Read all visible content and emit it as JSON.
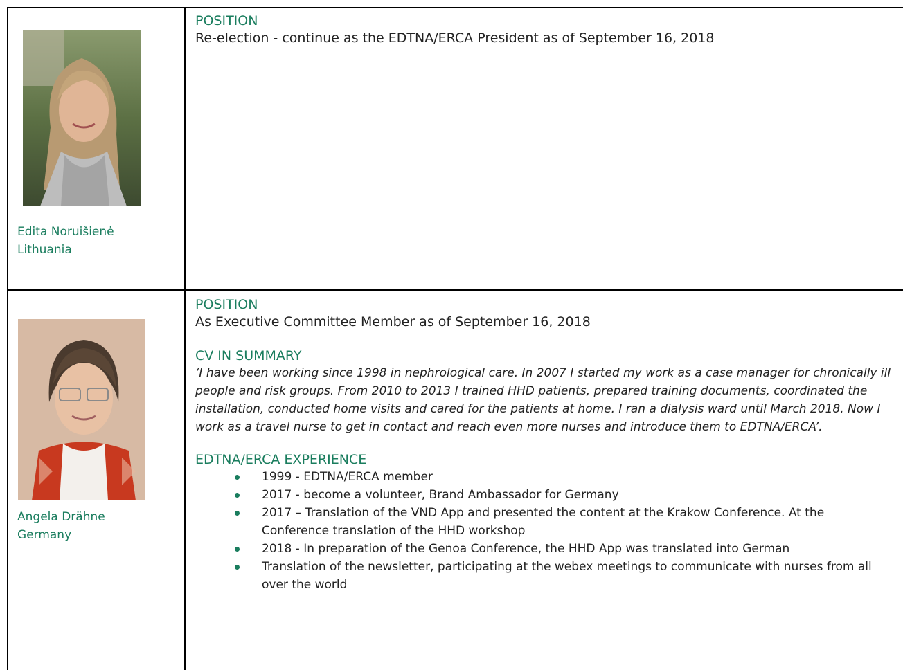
{
  "rows": [
    {
      "name": "Edita Noruišienė",
      "country": "Lithuania",
      "position_heading": "POSITION",
      "position_text": "Re-election - continue as the EDTNA/ERCA President as of September 16, 2018"
    },
    {
      "name": "Angela Drähne",
      "country": "Germany",
      "position_heading": "POSITION",
      "position_text": "As Executive Committee Member as of September 16, 2018",
      "cv_heading": "CV IN SUMMARY",
      "cv_text": "‘I have been working since 1998 in nephrological care. In 2007 I started my work as a case manager for chronically ill people and risk groups. From 2010 to 2013 I trained HHD patients, prepared training documents, coordinated the installation, conducted home visits and cared for the patients at home. I ran a dialysis ward until March 2018. Now I work as a travel nurse to get in contact and reach even more nurses and introduce them to EDTNA/ERCA’.",
      "experience_heading": "EDTNA/ERCA EXPERIENCE",
      "experience": [
        "1999 - EDTNA/ERCA member",
        "2017 - become a volunteer, Brand Ambassador for Germany",
        "2017 – Translation of the VND App and presented the content at the Krakow Conference. At the Conference translation of the HHD workshop",
        "2018 - In preparation of the Genoa Conference, the HHD App was translated into German",
        "Translation of the newsletter, participating at the webex meetings to communicate with nurses from all over the world"
      ]
    }
  ],
  "colors": {
    "accent": "#1a7d5e",
    "text": "#222222",
    "border": "#000000"
  }
}
